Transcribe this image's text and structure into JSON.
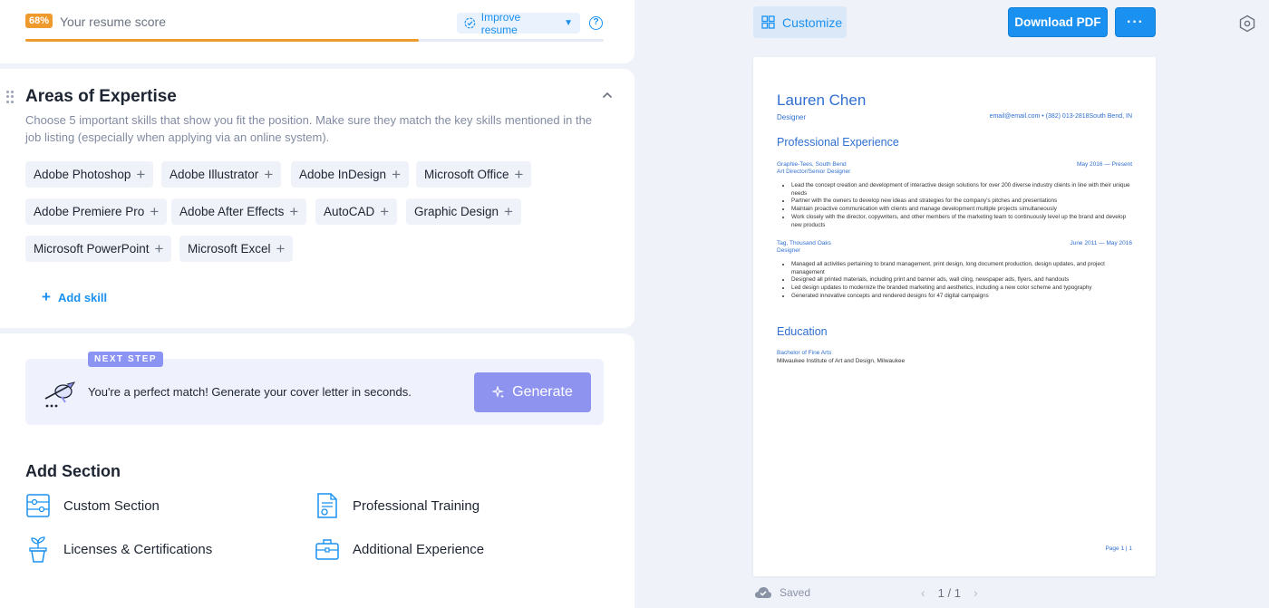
{
  "score": {
    "percent_label": "68%",
    "percent_value": 68,
    "label": "Your resume score",
    "improve_label": "Improve resume",
    "help": "?"
  },
  "expertise": {
    "title": "Areas of Expertise",
    "description": "Choose 5 important skills that show you fit the position. Make sure they match the key skills mentioned in the job listing (especially when applying via an online system).",
    "skills": [
      "Adobe Photoshop",
      "Adobe Illustrator",
      "Adobe InDesign",
      "Microsoft Office",
      "Adobe Premiere Pro",
      "Adobe After Effects",
      "AutoCAD",
      "Graphic Design",
      "Microsoft PowerPoint",
      "Microsoft Excel"
    ],
    "add_skill": "Add skill"
  },
  "next_step": {
    "tag": "NEXT STEP",
    "text": "You're a perfect match! Generate your cover letter in seconds.",
    "button": "Generate"
  },
  "add_section": {
    "title": "Add Section",
    "items": [
      "Custom Section",
      "Professional Training",
      "Licenses & Certifications",
      "Additional Experience"
    ]
  },
  "toolbar": {
    "customize": "Customize",
    "download": "Download PDF",
    "more": "···"
  },
  "resume": {
    "name": "Lauren Chen",
    "job": "Designer",
    "contact": "email@email.com • (382) 013-2818South Bend, IN",
    "exp_heading": "Professional Experience",
    "jobs": [
      {
        "company": "Graphie-Tees, South Bend",
        "role": "Art Director/Senior Designer",
        "dates": "May 2016 — Present",
        "bullets": [
          "Lead the concept creation and development of interactive design solutions for over 200 diverse industry clients in line with their unique needs",
          "Partner with the owners to develop new ideas and strategies for the company's pitches and presentations",
          "Maintain proactive communication with clients and manage development multiple projects simultaneously",
          "Work closely with the director, copywriters, and other members of the marketing team to continuously level up the brand and develop new products"
        ]
      },
      {
        "company": "Tag, Thousand Oaks",
        "role": "Designer",
        "dates": "June 2011 — May 2016",
        "bullets": [
          "Managed all activities pertaining to brand management, print design, long document production, design updates, and project management",
          "Designed all printed materials, including print and banner ads, wall cling, newspaper ads, flyers, and handouts",
          "Led design updates to modernize the branded marketing and aesthetics, including a new color scheme and typography",
          "Generated innovative concepts and rendered designs for 47 digital campaigns"
        ]
      }
    ],
    "edu_heading": "Education",
    "degree": "Bachelor of Fine Arts",
    "school": "Milwaukee Institute of Art and Design, Milwaukee",
    "page": "Page 1 | 1"
  },
  "footer": {
    "saved": "Saved",
    "pager": "1 / 1"
  },
  "colors": {
    "accent": "#1a91f0",
    "score": "#ef9a2c",
    "generate": "#8d93ef"
  }
}
